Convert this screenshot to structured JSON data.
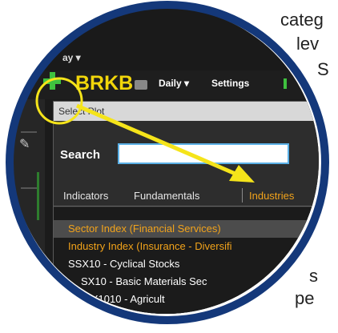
{
  "background_text": [
    "categ",
    "lev",
    "S",
    "s",
    "pe"
  ],
  "toolbar": {
    "days_label": "ay ▾",
    "symbol": "BRKB",
    "interval_label": "Daily ▾",
    "settings_label": "Settings"
  },
  "dialog": {
    "title": "Select Plot",
    "search_label": "Search",
    "search_value": "",
    "tabs": [
      "Indicators",
      "Fundamentals",
      "Industries"
    ],
    "active_tab": "Industries",
    "rows": [
      {
        "text": "Sector Index (Financial Services)",
        "color": "#f2a31b",
        "selected": true
      },
      {
        "text": "Industry Index (Insurance - Diversifi",
        "color": "#f2a31b",
        "selected": false
      },
      {
        "text": "SSX10 - Cyclical Stocks",
        "color": "#ffffff",
        "selected": false
      },
      {
        "text": "SX10 - Basic Materials Sec",
        "color": "#ffffff",
        "selected": false
      },
      {
        "text": "iX1010 - Agricult",
        "color": "#ffffff",
        "selected": false
      }
    ]
  },
  "colors": {
    "ring": "#14387a",
    "annotation": "#f5e41a",
    "accent_orange": "#f2a31b",
    "symbol_yellow": "#f2d60a"
  }
}
